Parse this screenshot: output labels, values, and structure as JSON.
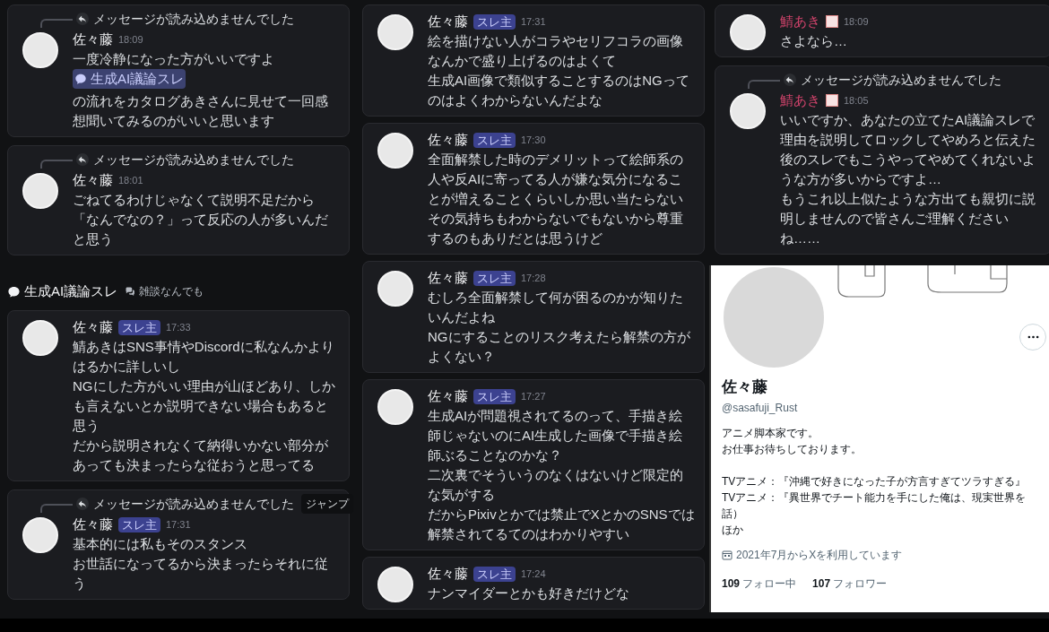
{
  "columns": [
    {
      "items": [
        {
          "kind": "message",
          "reply": "メッセージが読み込めませんでした",
          "author": "佐々藤",
          "color": "#f2f3f5",
          "role_icon": false,
          "time": "18:09",
          "body": [
            [
              {
                "kind": "text",
                "text": "一度冷静になった方がいいですよ"
              }
            ],
            [
              {
                "kind": "channel",
                "text": "生成AI議論スレ"
              }
            ],
            [
              {
                "kind": "text",
                "text": "の流れをカタログあきさんに見せて一回感想聞いてみるのがいいと思います"
              }
            ]
          ]
        },
        {
          "kind": "message",
          "reply": "メッセージが読み込めませんでした",
          "author": "佐々藤",
          "color": "#f2f3f5",
          "role_icon": false,
          "time": "18:01",
          "body": [
            [
              {
                "kind": "text",
                "text": "ごねてるわけじゃなくて説明不足だから「なんでなの？」って反応の人が多いんだと思う"
              }
            ]
          ]
        },
        {
          "kind": "thread_header",
          "title": "生成AI議論スレ",
          "parent": "雑談なんでも"
        },
        {
          "kind": "message",
          "author": "佐々藤",
          "color": "#f2f3f5",
          "role_icon": false,
          "badge": "スレ主",
          "time": "17:33",
          "body": [
            [
              {
                "kind": "text",
                "text": "鯖あきはSNS事情やDiscordに私なんかよりはるかに詳しいし"
              }
            ],
            [
              {
                "kind": "text",
                "text": "NGにした方がいい理由が山ほどあり、しかも言えないとか説明できない場合もあると思う"
              }
            ],
            [
              {
                "kind": "text",
                "text": "だから説明されなくて納得いかない部分があっても決まったらな従おうと思ってる"
              }
            ]
          ]
        },
        {
          "kind": "message",
          "reply": "メッセージが読み込めませんでした",
          "jump": "ジャンプ",
          "author": "佐々藤",
          "color": "#f2f3f5",
          "role_icon": false,
          "badge": "スレ主",
          "time": "17:31",
          "body": [
            [
              {
                "kind": "text",
                "text": "基本的には私もそのスタンス"
              }
            ],
            [
              {
                "kind": "text",
                "text": "お世話になってるから決まったらそれに従う"
              }
            ]
          ]
        }
      ]
    },
    {
      "items": [
        {
          "kind": "message",
          "author": "佐々藤",
          "color": "#f2f3f5",
          "role_icon": false,
          "badge": "スレ主",
          "time": "17:31",
          "body": [
            [
              {
                "kind": "text",
                "text": "絵を描けない人がコラやセリフコラの画像なんかで盛り上げるのはよくて"
              }
            ],
            [
              {
                "kind": "text",
                "text": "生成AI画像で類似することするのはNGってのはよくわからないんだよな"
              }
            ]
          ]
        },
        {
          "kind": "message",
          "author": "佐々藤",
          "color": "#f2f3f5",
          "role_icon": false,
          "badge": "スレ主",
          "time": "17:30",
          "body": [
            [
              {
                "kind": "text",
                "text": "全面解禁した時のデメリットって絵師系の人や反AIに寄ってる人が嫌な気分になることが増えることくらいしか思い当たらない"
              }
            ],
            [
              {
                "kind": "text",
                "text": "その気持ちもわからないでもないから尊重するのもありだとは思うけど"
              }
            ]
          ]
        },
        {
          "kind": "message",
          "author": "佐々藤",
          "color": "#f2f3f5",
          "role_icon": false,
          "badge": "スレ主",
          "time": "17:28",
          "body": [
            [
              {
                "kind": "text",
                "text": "むしろ全面解禁して何が困るのかが知りたいんだよね"
              }
            ],
            [
              {
                "kind": "text",
                "text": "NGにすることのリスク考えたら解禁の方がよくない？"
              }
            ]
          ]
        },
        {
          "kind": "message",
          "author": "佐々藤",
          "color": "#f2f3f5",
          "role_icon": false,
          "badge": "スレ主",
          "time": "17:27",
          "body": [
            [
              {
                "kind": "text",
                "text": "生成AIが問題視されてるのって、手描き絵師じゃないのにAI生成した画像で手描き絵師ぶることなのかな？"
              }
            ],
            [
              {
                "kind": "text",
                "text": "二次裏でそういうのなくはないけど限定的な気がする"
              }
            ],
            [
              {
                "kind": "text",
                "text": "だからPixivとかでは禁止でXとかのSNSでは解禁されてるてのはわかりやすい"
              }
            ]
          ]
        },
        {
          "kind": "message",
          "author": "佐々藤",
          "color": "#f2f3f5",
          "role_icon": false,
          "badge": "スレ主",
          "time": "17:24",
          "body": [
            [
              {
                "kind": "text",
                "text": "ナンマイダーとかも好きだけどな"
              }
            ]
          ]
        }
      ]
    },
    {
      "items": [
        {
          "kind": "message",
          "author": "鯖あき",
          "color": "#d0436b",
          "role_icon": true,
          "time": "18:09",
          "body": [
            [
              {
                "kind": "text",
                "text": "さよなら…"
              }
            ]
          ]
        },
        {
          "kind": "message",
          "reply": "メッセージが読み込めませんでした",
          "author": "鯖あき",
          "color": "#d0436b",
          "role_icon": true,
          "time": "18:05",
          "body": [
            [
              {
                "kind": "text",
                "text": "いいですか、あなたの立てたAI議論スレで理由を説明してロックしてやめろと伝えた後のスレでもこうやってやめてくれないような方が多いからですよ…"
              }
            ],
            [
              {
                "kind": "text",
                "text": "もうこれ以上似たような方出ても親切に説明しませんので皆さんご理解くださいね……"
              }
            ]
          ]
        },
        {
          "kind": "profile",
          "name": "佐々藤",
          "handle": "@sasafuji_Rust",
          "bio": [
            [
              "アニメ脚本家です。",
              "お仕事お待ちしております。"
            ],
            [
              "TVアニメ：『沖縄で好きになった子が方言すぎてツラすぎる』",
              "TVアニメ：『異世界でチート能力を手にした俺は、現実世界を",
              "話）",
              "ほか"
            ]
          ],
          "joined": "2021年7月からXを利用しています",
          "following_count": "109",
          "following_label": "フォロー中",
          "followers_count": "107",
          "followers_label": "フォロワー"
        }
      ]
    }
  ]
}
